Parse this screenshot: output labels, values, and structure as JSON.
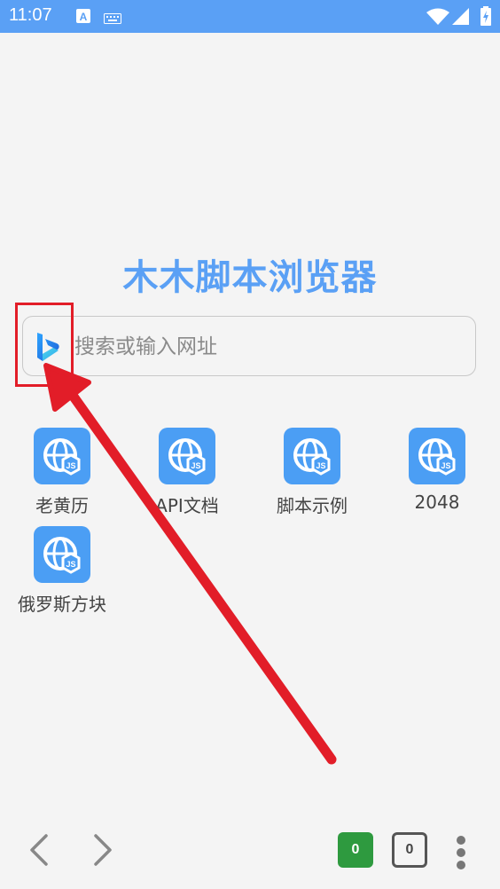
{
  "status_bar": {
    "time": "11:07",
    "icons": [
      "notification-a-icon",
      "keyboard-icon",
      "wifi-icon",
      "signal-icon",
      "battery-charging-icon"
    ]
  },
  "app": {
    "title": "木木脚本浏览器"
  },
  "search": {
    "placeholder": "搜索或输入网址",
    "value": "",
    "engine_icon": "bing-icon"
  },
  "shortcuts": [
    {
      "label": "老黄历",
      "icon": "globe-js-icon"
    },
    {
      "label": "API文档",
      "icon": "globe-js-icon"
    },
    {
      "label": "脚本示例",
      "icon": "globe-js-icon"
    },
    {
      "label": "2048",
      "icon": "globe-js-icon"
    },
    {
      "label": "俄罗斯方块",
      "icon": "globe-js-icon"
    }
  ],
  "bottom_bar": {
    "tabs_count_a": "0",
    "tabs_count_b": "0",
    "colors": {
      "green_badge": "#2e9a3f",
      "outline": "#555555"
    }
  },
  "colors": {
    "accent": "#5aa0f5",
    "tile": "#4b9ef4",
    "annotation": "#e21d28"
  }
}
